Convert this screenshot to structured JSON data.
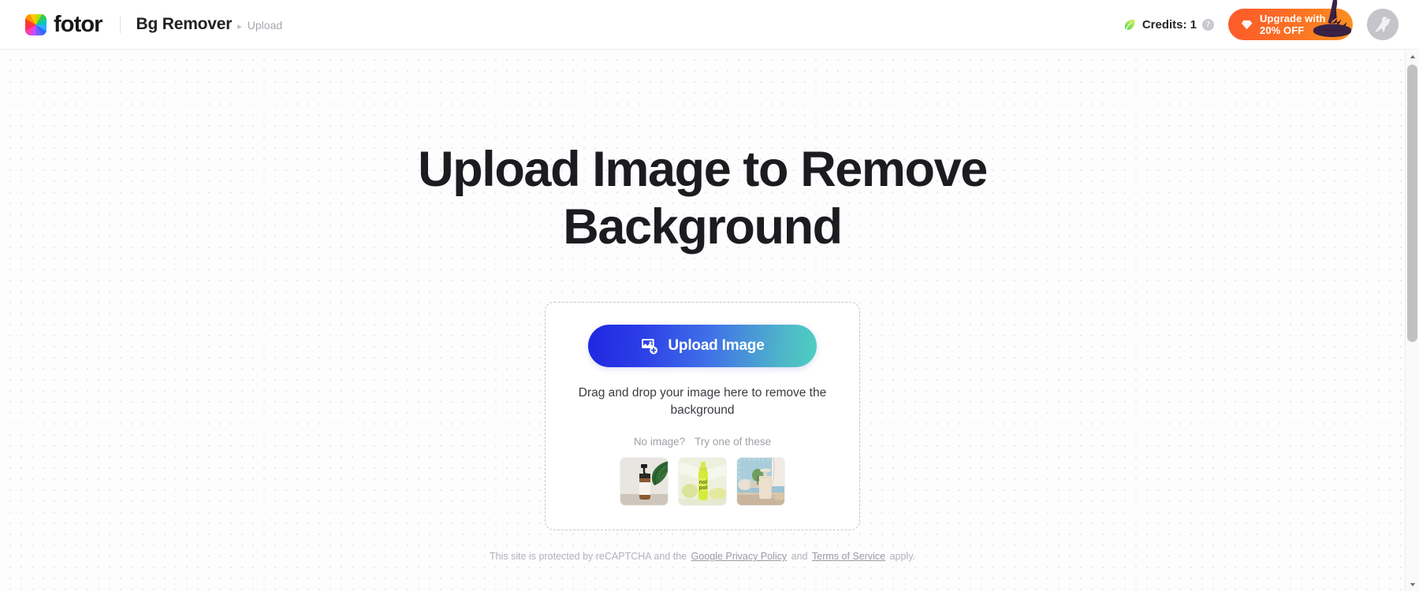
{
  "header": {
    "logo_name": "fotor",
    "logo_icon": "color-wheel-icon",
    "breadcrumb": {
      "title": "Bg Remover",
      "separator": "▸",
      "current": "Upload"
    },
    "credits": {
      "leaf_icon": "leaf-icon",
      "label": "Credits: 1",
      "help_icon": "?"
    },
    "upgrade": {
      "gem_icon": "diamond-icon",
      "line1": "Upgrade with",
      "line2": "20% OFF",
      "decoration_icon": "witch-hat-icon",
      "color": "#fb6b25"
    },
    "avatar_icon": "bird-avatar-icon"
  },
  "main": {
    "hero_title": "Upload Image to Remove Background",
    "upload_card": {
      "button": {
        "label": "Upload Image",
        "icon": "image-add-icon",
        "gradient_from": "#1f27e0",
        "gradient_to": "#4ed0c0"
      },
      "drag_text": "Drag and drop your image here to remove the background",
      "try_prompt": "No image?",
      "try_label": "Try one of these",
      "samples": [
        {
          "name": "sample-brown-pump-bottle",
          "alt": "Brown pump bottle with monstera leaf"
        },
        {
          "name": "sample-yellow-serum-bottle",
          "alt": "Yellow serum bottle"
        },
        {
          "name": "sample-beige-soap-dispenser",
          "alt": "Beige soap dispenser"
        }
      ]
    },
    "recaptcha": {
      "prefix": "This site is protected by reCAPTCHA and the",
      "link1": "Google Privacy Policy",
      "middle": "and",
      "link2": "Terms of Service",
      "suffix": "apply."
    }
  },
  "scrollbar": {
    "up_arrow": "▲",
    "down_arrow": "▼"
  }
}
